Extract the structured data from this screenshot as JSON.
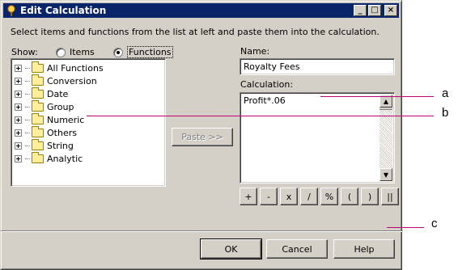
{
  "window": {
    "title": "Edit Calculation"
  },
  "titlebar_buttons": {
    "minimize": "_",
    "maximize": "□",
    "close": "×"
  },
  "instruction": "Select items and functions from the list at left and paste them into the calculation.",
  "show": {
    "label": "Show:",
    "options": [
      "Items",
      "Functions"
    ],
    "selected": "Functions"
  },
  "tree": {
    "items": [
      {
        "label": "All Functions"
      },
      {
        "label": "Conversion"
      },
      {
        "label": "Date"
      },
      {
        "label": "Group"
      },
      {
        "label": "Numeric"
      },
      {
        "label": "Others"
      },
      {
        "label": "String"
      },
      {
        "label": "Analytic"
      }
    ]
  },
  "paste_button": "Paste >>",
  "name": {
    "label": "Name:",
    "value": "Royalty Fees"
  },
  "calculation": {
    "label": "Calculation:",
    "value": "Profit*.06"
  },
  "operators": [
    "+",
    "-",
    "x",
    "/",
    "%",
    "(",
    ")",
    "||"
  ],
  "buttons": {
    "ok": "OK",
    "cancel": "Cancel",
    "help": "Help"
  },
  "callouts": {
    "a": "a",
    "b": "b",
    "c": "c"
  },
  "colors": {
    "titlebar": "#0a246a",
    "dialog": "#d4d0c8",
    "callout_line": "#c0007a"
  }
}
